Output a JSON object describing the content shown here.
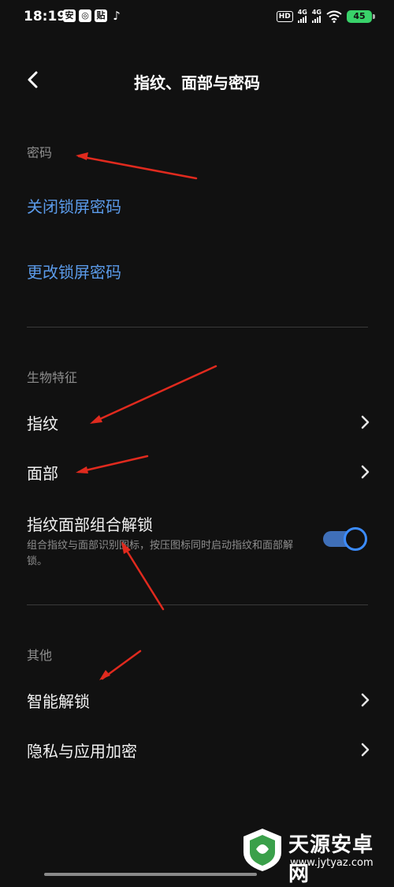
{
  "status_bar": {
    "time": "18:19",
    "notification_icons": [
      "安",
      "◎",
      "贴",
      "♪"
    ],
    "hd_label": "HD",
    "net1_label": "4G",
    "net2_label": "4G",
    "battery_level": "45"
  },
  "header": {
    "title": "指纹、面部与密码"
  },
  "sections": {
    "password": {
      "label": "密码",
      "close_lock": "关闭锁屏密码",
      "change_lock": "更改锁屏密码"
    },
    "biometric": {
      "label": "生物特征",
      "fingerprint": "指纹",
      "face": "面部",
      "combo_title": "指纹面部组合解锁",
      "combo_desc": "组合指纹与面部识别图标，按压图标同时启动指纹和面部解锁。",
      "combo_enabled": true
    },
    "other": {
      "label": "其他",
      "smart_unlock": "智能解锁",
      "privacy": "隐私与应用加密"
    }
  },
  "watermark": {
    "name": "天源安卓网",
    "url": "www.jytyaz.com"
  },
  "colors": {
    "background": "#111111",
    "link": "#5b9bea",
    "toggle_accent": "#3c8cff",
    "annotation_arrow": "#e02a1e"
  }
}
